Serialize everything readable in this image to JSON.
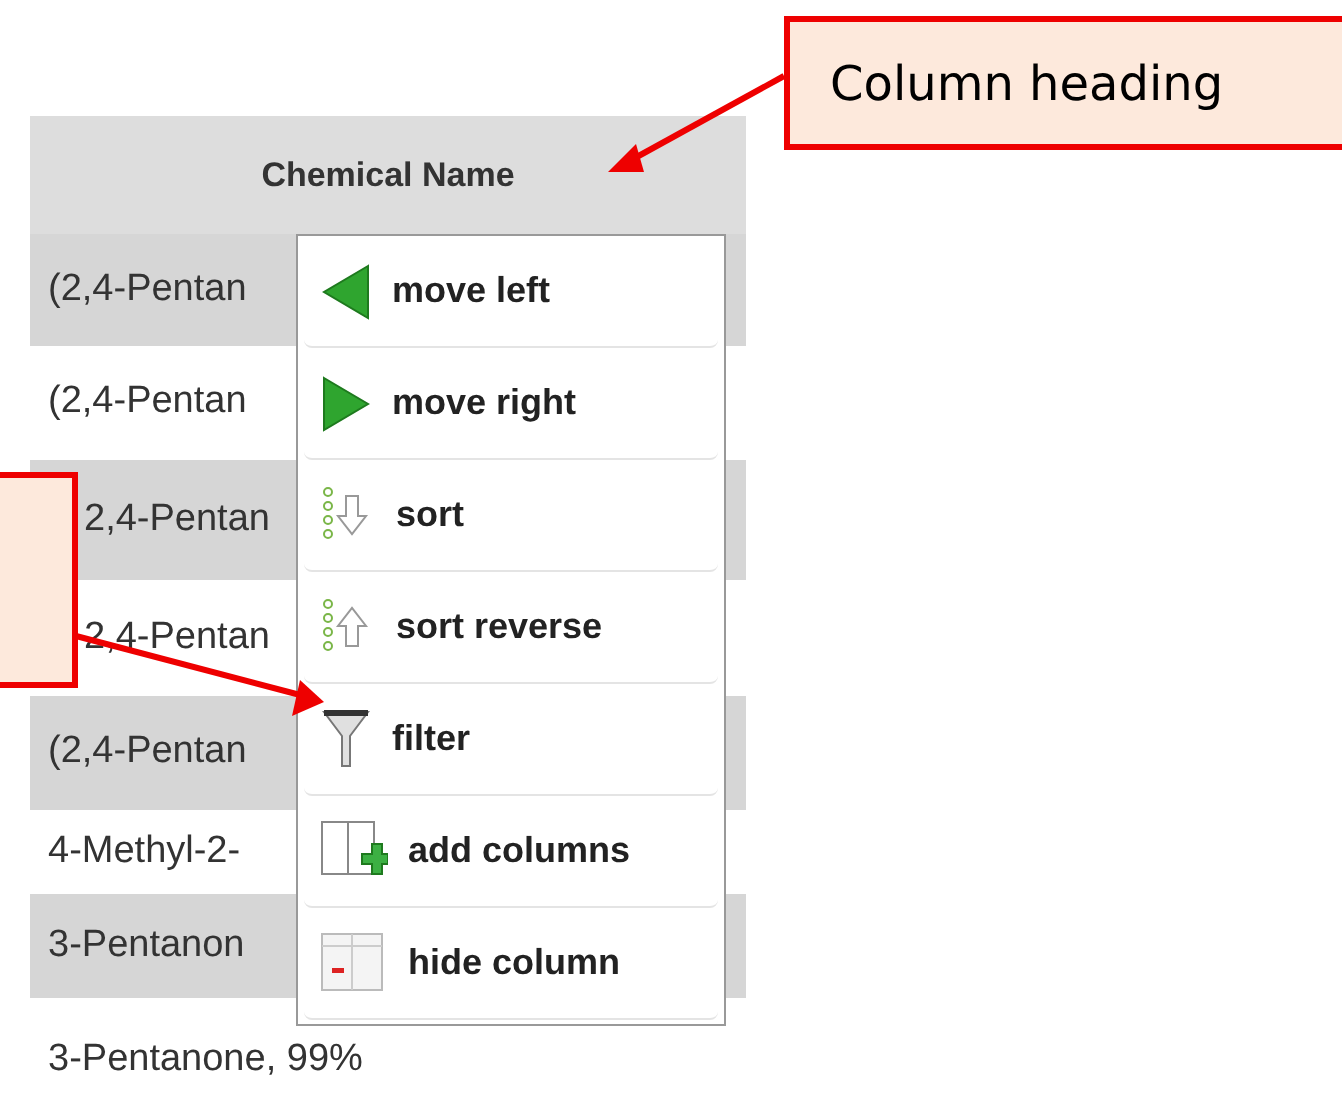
{
  "table": {
    "columns": [
      {
        "label": "Chemical Name"
      }
    ],
    "rows": [
      {
        "text": "(2,4-Pentan",
        "shaded": true
      },
      {
        "text": "(2,4-Pentan",
        "shaded": false
      },
      {
        "text": "2,4-Pentan",
        "shaded": true
      },
      {
        "text": "2,4-Pentan",
        "shaded": false
      },
      {
        "text": "(2,4-Pentan",
        "shaded": true
      },
      {
        "text": "4-Methyl-2-",
        "shaded": false
      },
      {
        "text": "3-Pentanon",
        "shaded": true
      },
      {
        "text": "3-Pentanone, 99%",
        "shaded": false
      }
    ]
  },
  "column_menu": {
    "items": [
      {
        "kind": "move-left",
        "label": "move left"
      },
      {
        "kind": "move-right",
        "label": "move right"
      },
      {
        "kind": "sort",
        "label": "sort"
      },
      {
        "kind": "sort-reverse",
        "label": "sort reverse"
      },
      {
        "kind": "filter",
        "label": "filter"
      },
      {
        "kind": "add-columns",
        "label": "add columns"
      },
      {
        "kind": "hide-column",
        "label": "hide column"
      }
    ]
  },
  "annotations": [
    {
      "kind": "heading-callout",
      "text": "Column heading"
    },
    {
      "kind": "filter-callout"
    }
  ]
}
